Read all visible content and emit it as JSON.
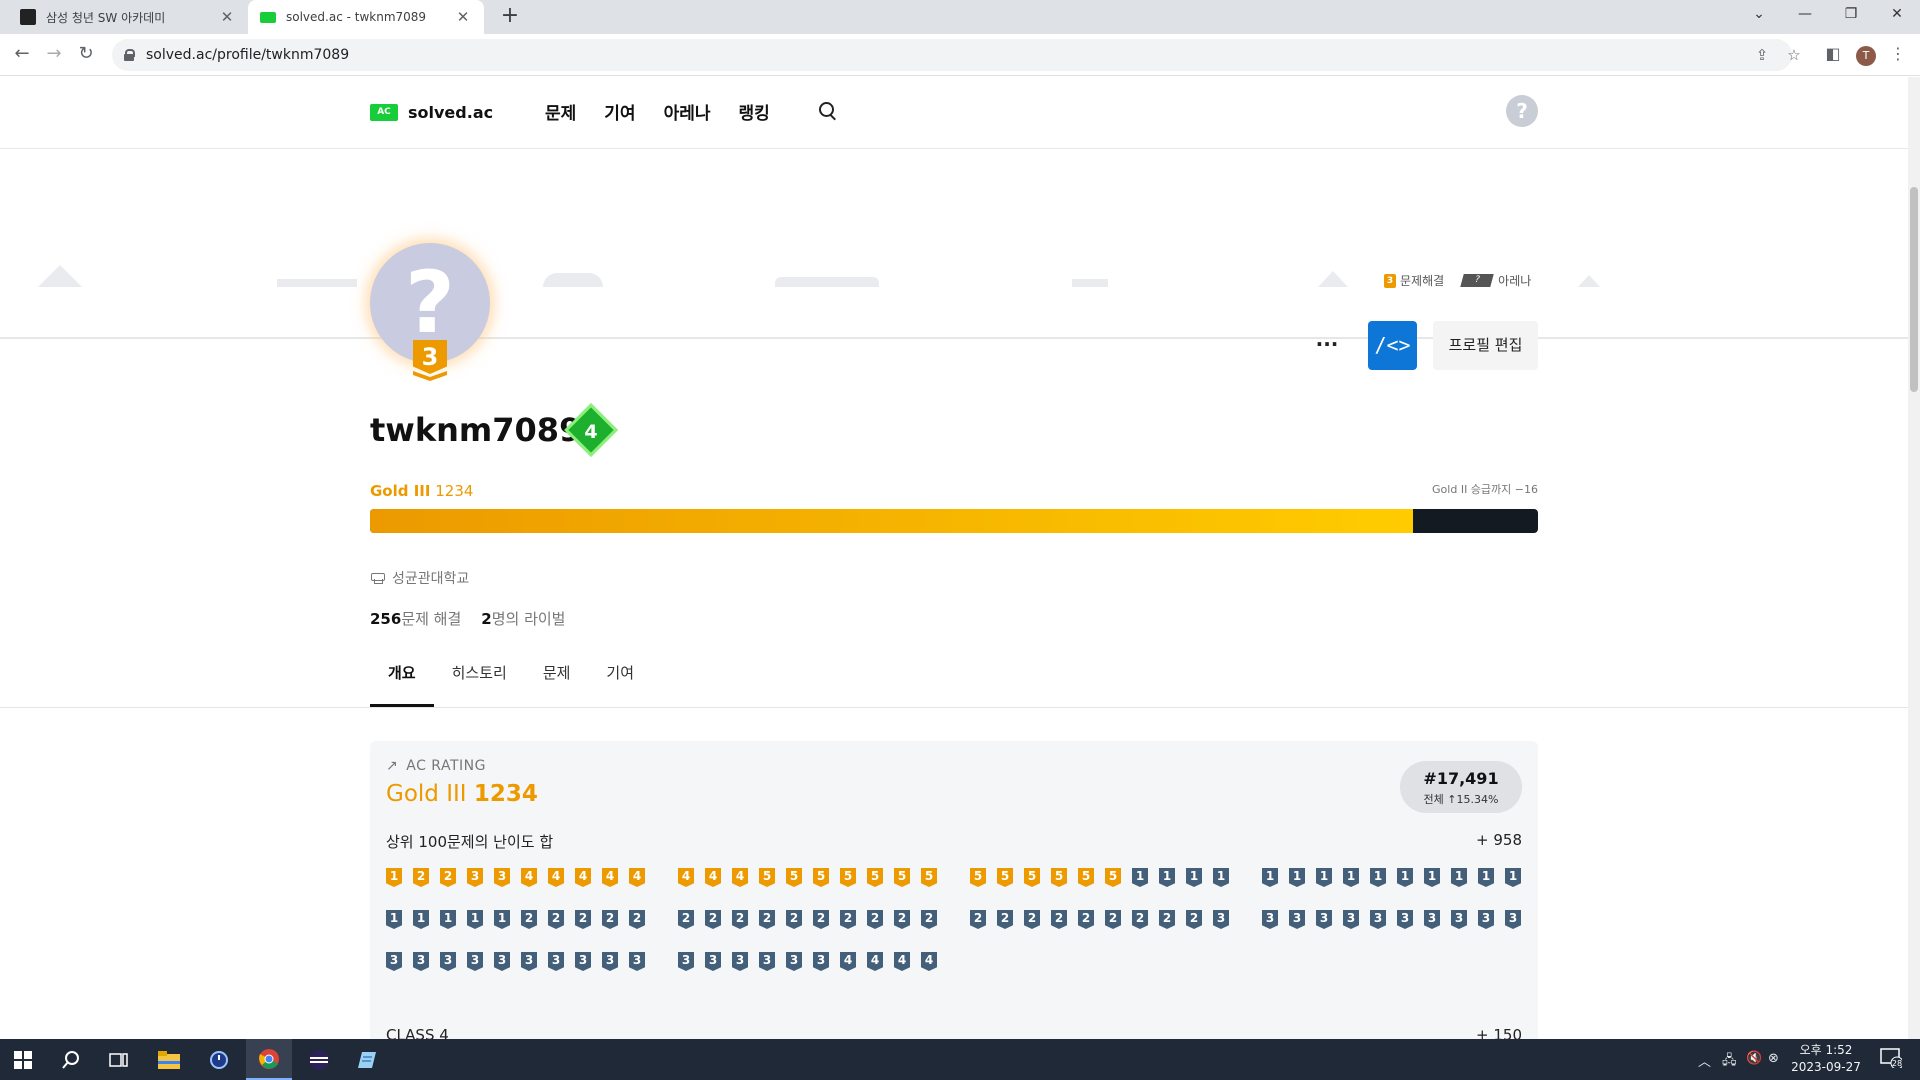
{
  "browser": {
    "tabs": [
      {
        "title": "삼성 청년 SW 아카데미",
        "favicon": "ssafy-favicon"
      },
      {
        "title": "solved.ac - twknm7089",
        "favicon": "solvedac-favicon"
      }
    ],
    "url": "solved.ac/profile/twknm7089",
    "profile_initial": "T"
  },
  "site": {
    "logo_badge": "AC",
    "logo_text": "solved.ac",
    "nav": [
      "문제",
      "기여",
      "아레나",
      "랭킹"
    ],
    "help": "?"
  },
  "banner_badges": {
    "problem_tier": "3",
    "problem_label": "문제해결",
    "arena_tier": "?",
    "arena_label": "아레나"
  },
  "profile": {
    "avatar_symbol": "?",
    "tier_number": "3",
    "username": "twknm7089",
    "class_number": "4",
    "tier_name": "Gold III",
    "rating": "1234",
    "promotion": "Gold II 승급까지 −16",
    "rating_progress": 0.893,
    "school": "성균관대학교",
    "solved_count": "256",
    "solved_label": "문제 해결",
    "rival_count": "2",
    "rival_label": "명의 라이벌",
    "more": "···",
    "code_button": "/<>",
    "edit_button": "프로필 편집"
  },
  "profile_tabs": [
    "개요",
    "히스토리",
    "문제",
    "기여"
  ],
  "ac_rating": {
    "heading": "AC RATING",
    "tier_name": "Gold III",
    "rating": "1234",
    "rank": "#17,491",
    "rank_detail": "전체 ↑15.34%",
    "top100_label": "상위 100문제의 난이도 합",
    "top100_value": "+ 958",
    "class_label": "CLASS 4",
    "class_value": "+ 150",
    "top100_tiers": [
      "G1",
      "G2",
      "G2",
      "G3",
      "G3",
      "G4",
      "G4",
      "G4",
      "G4",
      "G4",
      "G4",
      "G4",
      "G4",
      "G5",
      "G5",
      "G5",
      "G5",
      "G5",
      "G5",
      "G5",
      "G5",
      "G5",
      "G5",
      "G5",
      "G5",
      "G5",
      "P1",
      "P1",
      "P1",
      "P1",
      "P1",
      "P1",
      "P1",
      "P1",
      "P1",
      "P1",
      "P1",
      "P1",
      "P1",
      "P1",
      "P1",
      "P1",
      "P1",
      "P1",
      "P1",
      "P2",
      "P2",
      "P2",
      "P2",
      "P2",
      "P2",
      "P2",
      "P2",
      "P2",
      "P2",
      "P2",
      "P2",
      "P2",
      "P2",
      "P2",
      "P2",
      "P2",
      "P2",
      "P2",
      "P2",
      "P2",
      "P2",
      "P2",
      "P2",
      "P3",
      "P3",
      "P3",
      "P3",
      "P3",
      "P3",
      "P3",
      "P3",
      "P3",
      "P3",
      "P3",
      "P3",
      "P3",
      "P3",
      "P3",
      "P3",
      "P3",
      "P3",
      "P3",
      "P3",
      "P3",
      "P3",
      "P3",
      "P3",
      "P3",
      "P3",
      "P3",
      "P4",
      "P4",
      "P4",
      "P4"
    ]
  },
  "taskbar": {
    "clock_line1": "오후 1:52",
    "clock_line2": "2023-09-27",
    "notifications": "28"
  }
}
